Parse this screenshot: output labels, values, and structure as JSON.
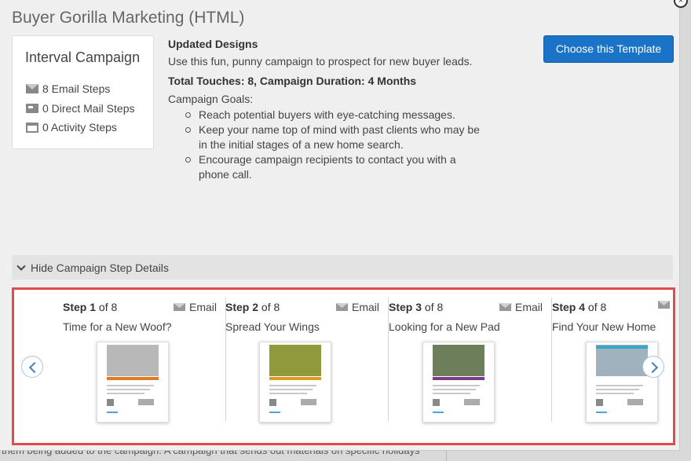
{
  "backdrop": {
    "text": "them being added to the campaign. A campaign that sends out materials on specific holidays"
  },
  "modal": {
    "title": "Buyer Gorilla Marketing (HTML)",
    "close_label": "×"
  },
  "summary": {
    "title": "Interval Campaign",
    "email_steps": "8 Email Steps",
    "direct_mail_steps": "0 Direct Mail Steps",
    "activity_steps": "0 Activity Steps"
  },
  "description": {
    "heading": "Updated Designs",
    "text": "Use this fun, punny campaign to prospect for new buyer leads.",
    "touches": "Total Touches: 8, Campaign Duration: 4 Months",
    "goals_title": "Campaign Goals:",
    "goals": [
      "Reach potential buyers with eye-catching messages.",
      "Keep your name top of mind with past clients who may be in the initial stages of a new home search.",
      "Encourage campaign recipients to contact you with a phone call."
    ]
  },
  "choose_button": "Choose this Template",
  "toggle": {
    "label": "Hide Campaign Step Details"
  },
  "steps": [
    {
      "step": "Step 1",
      "of": "of 8",
      "type": "Email",
      "title": "Time for a New Woof?",
      "image_colors": [
        "#b8b8b8",
        "#e07b24"
      ]
    },
    {
      "step": "Step 2",
      "of": "of 8",
      "type": "Email",
      "title": "Spread Your Wings",
      "image_colors": [
        "#8f9a3c",
        "#e09a24"
      ]
    },
    {
      "step": "Step 3",
      "of": "of 8",
      "type": "Email",
      "title": "Looking for a New Pad",
      "image_colors": [
        "#6c7f5a",
        "#7b3a8a"
      ]
    },
    {
      "step": "Step 4",
      "of": "of 8",
      "type": "",
      "title": "Find Your New Home",
      "image_colors": [
        "#9fb2bd",
        "#3aa6c8"
      ]
    }
  ],
  "colors": {
    "primary": "#1a73c7",
    "highlight_border": "#e04b4b"
  }
}
